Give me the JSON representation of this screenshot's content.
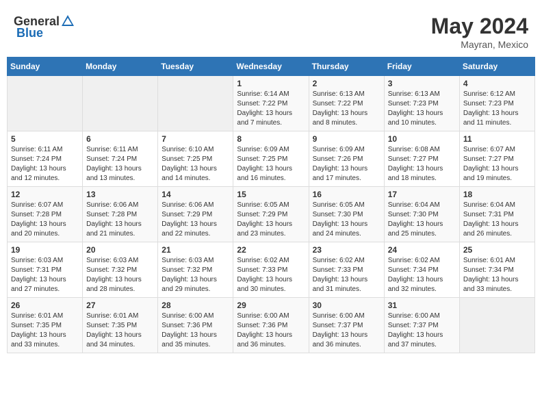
{
  "header": {
    "logo_general": "General",
    "logo_blue": "Blue",
    "month_year": "May 2024",
    "location": "Mayran, Mexico"
  },
  "days_of_week": [
    "Sunday",
    "Monday",
    "Tuesday",
    "Wednesday",
    "Thursday",
    "Friday",
    "Saturday"
  ],
  "weeks": [
    [
      {
        "day": "",
        "content": ""
      },
      {
        "day": "",
        "content": ""
      },
      {
        "day": "",
        "content": ""
      },
      {
        "day": "1",
        "content": "Sunrise: 6:14 AM\nSunset: 7:22 PM\nDaylight: 13 hours and 7 minutes."
      },
      {
        "day": "2",
        "content": "Sunrise: 6:13 AM\nSunset: 7:22 PM\nDaylight: 13 hours and 8 minutes."
      },
      {
        "day": "3",
        "content": "Sunrise: 6:13 AM\nSunset: 7:23 PM\nDaylight: 13 hours and 10 minutes."
      },
      {
        "day": "4",
        "content": "Sunrise: 6:12 AM\nSunset: 7:23 PM\nDaylight: 13 hours and 11 minutes."
      }
    ],
    [
      {
        "day": "5",
        "content": "Sunrise: 6:11 AM\nSunset: 7:24 PM\nDaylight: 13 hours and 12 minutes."
      },
      {
        "day": "6",
        "content": "Sunrise: 6:11 AM\nSunset: 7:24 PM\nDaylight: 13 hours and 13 minutes."
      },
      {
        "day": "7",
        "content": "Sunrise: 6:10 AM\nSunset: 7:25 PM\nDaylight: 13 hours and 14 minutes."
      },
      {
        "day": "8",
        "content": "Sunrise: 6:09 AM\nSunset: 7:25 PM\nDaylight: 13 hours and 16 minutes."
      },
      {
        "day": "9",
        "content": "Sunrise: 6:09 AM\nSunset: 7:26 PM\nDaylight: 13 hours and 17 minutes."
      },
      {
        "day": "10",
        "content": "Sunrise: 6:08 AM\nSunset: 7:27 PM\nDaylight: 13 hours and 18 minutes."
      },
      {
        "day": "11",
        "content": "Sunrise: 6:07 AM\nSunset: 7:27 PM\nDaylight: 13 hours and 19 minutes."
      }
    ],
    [
      {
        "day": "12",
        "content": "Sunrise: 6:07 AM\nSunset: 7:28 PM\nDaylight: 13 hours and 20 minutes."
      },
      {
        "day": "13",
        "content": "Sunrise: 6:06 AM\nSunset: 7:28 PM\nDaylight: 13 hours and 21 minutes."
      },
      {
        "day": "14",
        "content": "Sunrise: 6:06 AM\nSunset: 7:29 PM\nDaylight: 13 hours and 22 minutes."
      },
      {
        "day": "15",
        "content": "Sunrise: 6:05 AM\nSunset: 7:29 PM\nDaylight: 13 hours and 23 minutes."
      },
      {
        "day": "16",
        "content": "Sunrise: 6:05 AM\nSunset: 7:30 PM\nDaylight: 13 hours and 24 minutes."
      },
      {
        "day": "17",
        "content": "Sunrise: 6:04 AM\nSunset: 7:30 PM\nDaylight: 13 hours and 25 minutes."
      },
      {
        "day": "18",
        "content": "Sunrise: 6:04 AM\nSunset: 7:31 PM\nDaylight: 13 hours and 26 minutes."
      }
    ],
    [
      {
        "day": "19",
        "content": "Sunrise: 6:03 AM\nSunset: 7:31 PM\nDaylight: 13 hours and 27 minutes."
      },
      {
        "day": "20",
        "content": "Sunrise: 6:03 AM\nSunset: 7:32 PM\nDaylight: 13 hours and 28 minutes."
      },
      {
        "day": "21",
        "content": "Sunrise: 6:03 AM\nSunset: 7:32 PM\nDaylight: 13 hours and 29 minutes."
      },
      {
        "day": "22",
        "content": "Sunrise: 6:02 AM\nSunset: 7:33 PM\nDaylight: 13 hours and 30 minutes."
      },
      {
        "day": "23",
        "content": "Sunrise: 6:02 AM\nSunset: 7:33 PM\nDaylight: 13 hours and 31 minutes."
      },
      {
        "day": "24",
        "content": "Sunrise: 6:02 AM\nSunset: 7:34 PM\nDaylight: 13 hours and 32 minutes."
      },
      {
        "day": "25",
        "content": "Sunrise: 6:01 AM\nSunset: 7:34 PM\nDaylight: 13 hours and 33 minutes."
      }
    ],
    [
      {
        "day": "26",
        "content": "Sunrise: 6:01 AM\nSunset: 7:35 PM\nDaylight: 13 hours and 33 minutes."
      },
      {
        "day": "27",
        "content": "Sunrise: 6:01 AM\nSunset: 7:35 PM\nDaylight: 13 hours and 34 minutes."
      },
      {
        "day": "28",
        "content": "Sunrise: 6:00 AM\nSunset: 7:36 PM\nDaylight: 13 hours and 35 minutes."
      },
      {
        "day": "29",
        "content": "Sunrise: 6:00 AM\nSunset: 7:36 PM\nDaylight: 13 hours and 36 minutes."
      },
      {
        "day": "30",
        "content": "Sunrise: 6:00 AM\nSunset: 7:37 PM\nDaylight: 13 hours and 36 minutes."
      },
      {
        "day": "31",
        "content": "Sunrise: 6:00 AM\nSunset: 7:37 PM\nDaylight: 13 hours and 37 minutes."
      },
      {
        "day": "",
        "content": ""
      }
    ]
  ]
}
